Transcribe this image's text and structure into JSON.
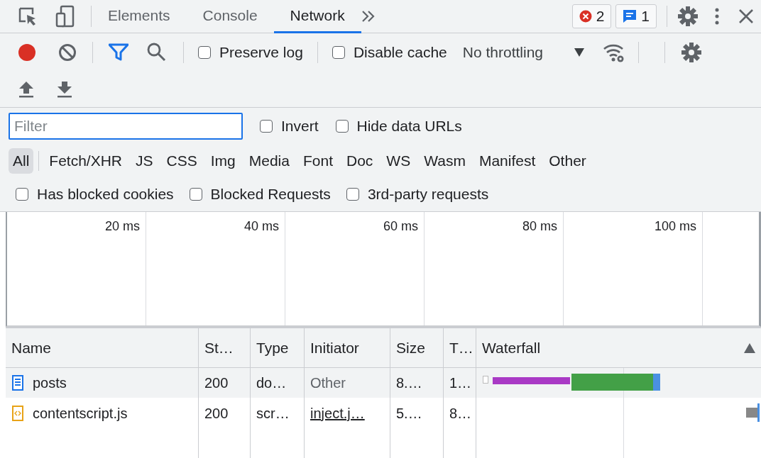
{
  "panel_tabs": [
    {
      "label": "Elements",
      "selected": false
    },
    {
      "label": "Console",
      "selected": false
    },
    {
      "label": "Network",
      "selected": true
    }
  ],
  "issues": {
    "errors": "2",
    "messages": "1"
  },
  "toolbar": {
    "recording": true,
    "preserve_log": {
      "label": "Preserve log",
      "checked": false
    },
    "disable_cache": {
      "label": "Disable cache",
      "checked": false
    },
    "throttling": "No throttling"
  },
  "filter": {
    "placeholder": "Filter",
    "invert": {
      "label": "Invert",
      "checked": false
    },
    "hide_data_urls": {
      "label": "Hide data URLs",
      "checked": false
    }
  },
  "type_filters": [
    {
      "label": "All",
      "selected": true
    },
    {
      "label": "Fetch/XHR",
      "selected": false
    },
    {
      "label": "JS",
      "selected": false
    },
    {
      "label": "CSS",
      "selected": false
    },
    {
      "label": "Img",
      "selected": false
    },
    {
      "label": "Media",
      "selected": false
    },
    {
      "label": "Font",
      "selected": false
    },
    {
      "label": "Doc",
      "selected": false
    },
    {
      "label": "WS",
      "selected": false
    },
    {
      "label": "Wasm",
      "selected": false
    },
    {
      "label": "Manifest",
      "selected": false
    },
    {
      "label": "Other",
      "selected": false
    }
  ],
  "request_filters": [
    {
      "label": "Has blocked cookies",
      "checked": false
    },
    {
      "label": "Blocked Requests",
      "checked": false
    },
    {
      "label": "3rd-party requests",
      "checked": false
    }
  ],
  "overview": {
    "ticks": [
      "20 ms",
      "40 ms",
      "60 ms",
      "80 ms",
      "100 ms"
    ]
  },
  "table": {
    "columns": [
      "Name",
      "St…",
      "Type",
      "Initiator",
      "Size",
      "T…",
      "Waterfall"
    ],
    "rows": [
      {
        "kind": "document",
        "name": "posts",
        "status": "200",
        "type": "do…",
        "initiator": "Other",
        "initiator_link": false,
        "size": "8.…",
        "time": "1…",
        "highlighted": true
      },
      {
        "kind": "script",
        "name": "contentscript.js",
        "status": "200",
        "type": "scr…",
        "initiator": "inject.j…",
        "initiator_link": true,
        "size": "5.…",
        "time": "8…",
        "highlighted": false
      }
    ]
  }
}
